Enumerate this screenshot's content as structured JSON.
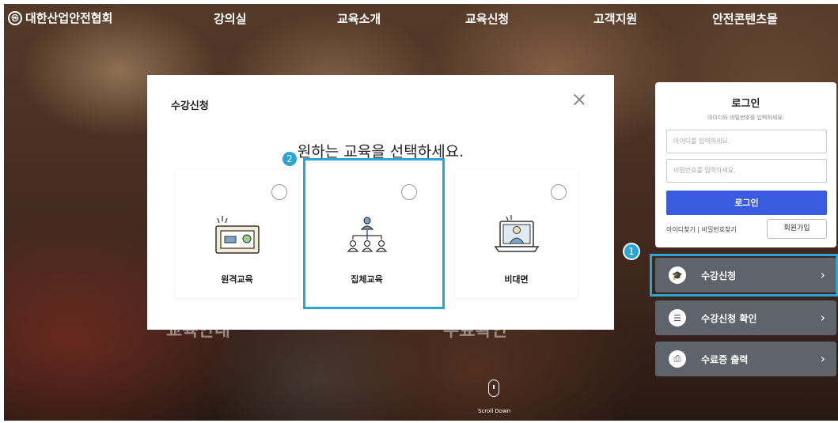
{
  "header": {
    "logo_text": "대한산업안전협회",
    "nav": [
      "강의실",
      "교육소개",
      "교육신청",
      "고객지원",
      "안전콘텐츠몰"
    ]
  },
  "modal": {
    "title": "수강신청",
    "heading": "원하는 교육을 선택하세요.",
    "cards": [
      {
        "label": "원격교육",
        "selected": false
      },
      {
        "label": "집체교육",
        "selected": false
      },
      {
        "label": "비대면",
        "selected": false
      }
    ]
  },
  "annotations": {
    "step1": "1",
    "step2": "2",
    "highlight_color": "#2aa6d6"
  },
  "login": {
    "title": "로그인",
    "subtitle": "아이디와 비밀번호를 입력하세요.",
    "id_placeholder": "아이디를 입력하세요.",
    "pw_placeholder": "비밀번호를 입력하세요.",
    "button": "로그인",
    "find_links": "아이디찾기 | 비밀번호찾기",
    "join": "회원가입",
    "button_color": "#3a5adf"
  },
  "side_menu": [
    {
      "label": "수강신청",
      "icon": "graduation-cap-icon"
    },
    {
      "label": "수강신청 확인",
      "icon": "list-icon"
    },
    {
      "label": "수료증 출력",
      "icon": "printer-icon"
    }
  ],
  "scroll": {
    "label": "Scroll Down"
  }
}
